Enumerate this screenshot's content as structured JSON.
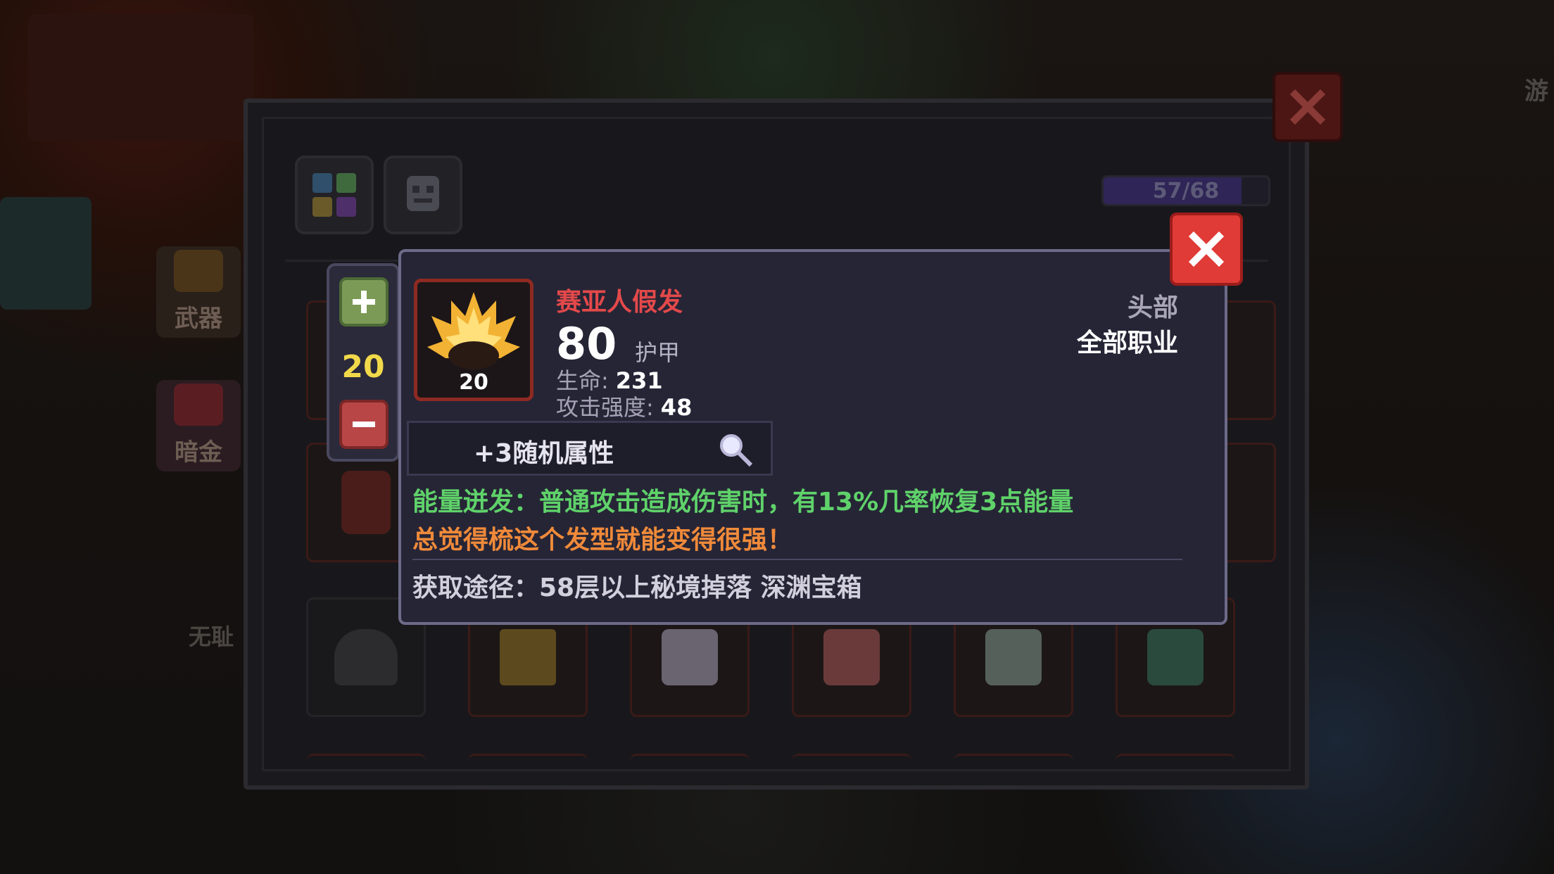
{
  "side_menu": {
    "weapon_label": "武器",
    "dark_gold_label": "暗金",
    "partial_label": "无耻",
    "edge_label": "游"
  },
  "inventory": {
    "count_text": "57/68",
    "capacity_fraction": 0.838
  },
  "quantity": {
    "value": "20"
  },
  "tooltip": {
    "item_name": "赛亚人假发",
    "item_level": "20",
    "armor_value": "80",
    "armor_label": "护甲",
    "hp_label": "生命:",
    "hp_value": "231",
    "attack_label": "攻击强度:",
    "attack_value": "48",
    "slot_type": "头部",
    "class_restriction": "全部职业",
    "random_attributes": "+3随机属性",
    "effect_text": "能量迸发：普通攻击造成伤害时，有13%几率恢复3点能量",
    "flavor_text": "总觉得梳这个发型就能变得很强！",
    "source_text": "获取途径：58层以上秘境掉落 深渊宝箱"
  },
  "colors": {
    "item_name": "#e4494a",
    "effect": "#5fd26a",
    "flavor": "#f08a3a",
    "quantity": "#f1d94a",
    "close_button": "#e03b36"
  },
  "icons": {
    "outer_close": "close-icon",
    "popup_close": "close-icon",
    "plus": "plus-icon",
    "minus": "minus-icon",
    "magnifier": "magnifier-icon",
    "tab_items": "grid-icon",
    "tab_pets": "monster-icon"
  }
}
